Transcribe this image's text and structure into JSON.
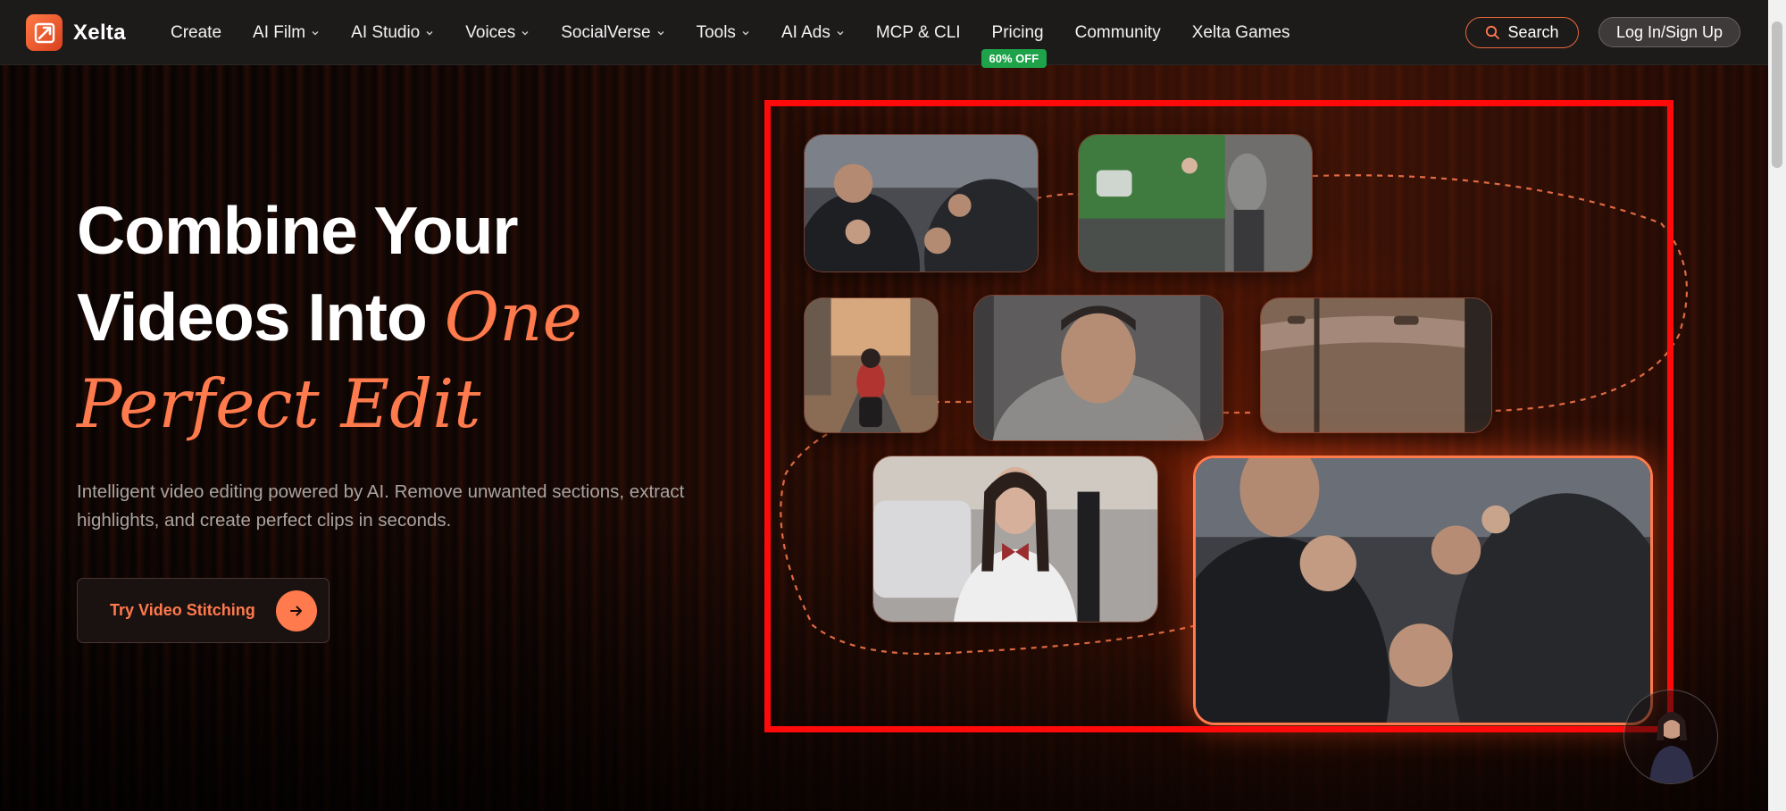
{
  "nav": {
    "brand": "Xelta",
    "items": [
      {
        "label": "Create",
        "dropdown": false
      },
      {
        "label": "AI Film",
        "dropdown": true
      },
      {
        "label": "AI Studio",
        "dropdown": true
      },
      {
        "label": "Voices",
        "dropdown": true
      },
      {
        "label": "SocialVerse",
        "dropdown": true
      },
      {
        "label": "Tools",
        "dropdown": true
      },
      {
        "label": "AI Ads",
        "dropdown": true
      },
      {
        "label": "MCP & CLI",
        "dropdown": false
      }
    ],
    "pricing": {
      "label": "Pricing",
      "badge": "60% OFF"
    },
    "community": "Community",
    "games": "Xelta Games",
    "search_label": "Search",
    "login_label": "Log In/Sign Up"
  },
  "hero": {
    "title_line1": "Combine Your",
    "title_line2_plain": "Videos Into ",
    "title_line2_accent": "One",
    "title_line3_accent": "Perfect Edit",
    "subtitle": "Intelligent video editing powered by AI. Remove unwanted sections, extract highlights, and create perfect clips in seconds.",
    "cta_label": "Try Video Stitching"
  },
  "colors": {
    "accent": "#ff7a4d",
    "badge_green": "#1fa34a",
    "frame_red": "#ff0a0a",
    "nav_bg": "#1d1a1a"
  },
  "collage": {
    "clips": [
      {
        "name": "clip-fight-closeup"
      },
      {
        "name": "clip-man-green-bus"
      },
      {
        "name": "clip-motorcycle-street"
      },
      {
        "name": "clip-man-grey-hoodie"
      },
      {
        "name": "clip-car-door"
      },
      {
        "name": "clip-schoolgirl-street"
      },
      {
        "name": "clip-fight-active"
      }
    ]
  }
}
